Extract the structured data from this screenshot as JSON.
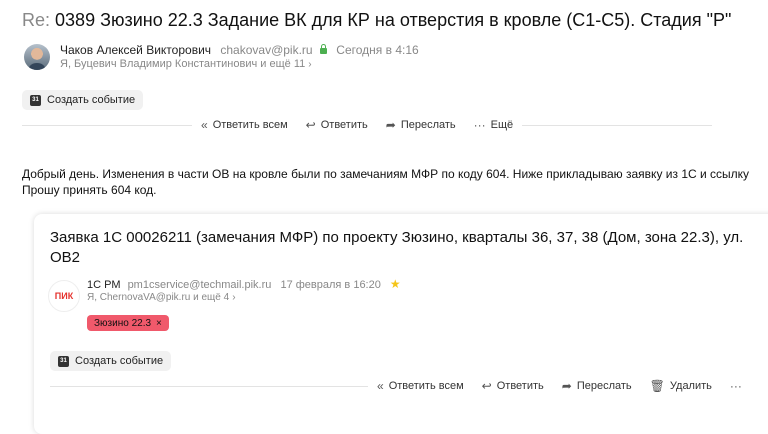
{
  "message": {
    "subject_prefix": "Re:",
    "subject": "0389 Зюзино 22.3 Задание ВК для КР на отверстия в кровле (С1-С5). Стадия \"Р\"",
    "sender_name": "Чаков Алексей Викторович",
    "sender_email": "chakovav@pik.ru",
    "date": "Сегодня в 4:16",
    "recipients": "Я, Буцевич Владимир Константинович и ещё 11",
    "create_event": "Создать событие",
    "actions": {
      "reply_all": "Ответить всем",
      "reply": "Ответить",
      "forward": "Переслать",
      "more": "Ещё"
    },
    "body_line1": "Добрый день. Изменения в части ОВ на кровле были по замечаниям МФР по коду 604. Ниже прикладываю заявку из 1С и ссылку",
    "body_line2": "Прошу принять 604 код."
  },
  "quoted": {
    "title_line1": "Заявка 1С 00026211 (замечания МФР) по проекту Зюзино, кварталы 36, 37, 38 (Дом, зона 22.3), ул.",
    "title_line2": "ОВ2",
    "logo_text": "ПИК",
    "sender_name": "1С РМ",
    "sender_email": "pm1cservice@techmail.pik.ru",
    "date": "17 февраля в 16:20",
    "recipients": "Я, ChernovaVA@pik.ru и ещё 4",
    "label": "Зюзино 22.3",
    "create_event": "Создать событие",
    "actions": {
      "reply_all": "Ответить всем",
      "reply": "Ответить",
      "forward": "Переслать",
      "delete": "Удалить"
    }
  },
  "colors": {
    "label_bg": "#f0596b",
    "star": "#f5c518",
    "lock": "#4caf50",
    "logo": "#e5322d"
  }
}
